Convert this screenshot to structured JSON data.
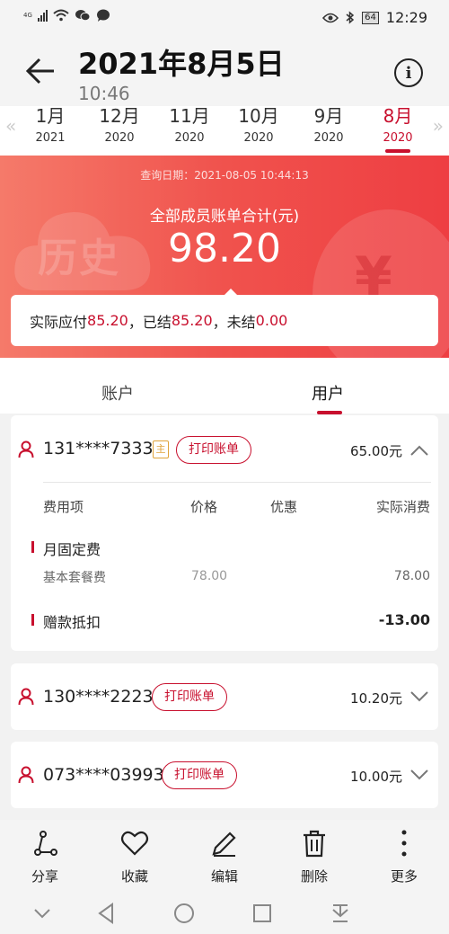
{
  "status_bar": {
    "network": "4G",
    "battery": "64",
    "time": "12:29"
  },
  "header": {
    "title": "2021年8月5日",
    "subtitle": "10:46"
  },
  "months": [
    {
      "month": "1月",
      "year": "2021"
    },
    {
      "month": "12月",
      "year": "2020"
    },
    {
      "month": "11月",
      "year": "2020"
    },
    {
      "month": "10月",
      "year": "2020"
    },
    {
      "month": "9月",
      "year": "2020"
    },
    {
      "month": "8月",
      "year": "2020"
    }
  ],
  "banner": {
    "query_date": "查询日期：2021-08-05 10:44:13",
    "total_label": "全部成员账单合计(元)",
    "total_value": "98.20",
    "watermark": "历史",
    "summary": {
      "payable_label": "实际应付",
      "payable_value": "85.20",
      "settled_label": "，已结",
      "settled_value": "85.20",
      "unsettled_label": "，未结",
      "unsettled_value": "0.00"
    }
  },
  "tabs": {
    "account": "账户",
    "user": "用户"
  },
  "bills": [
    {
      "phone": "131****7333",
      "badge": "主",
      "print_label": "打印账单",
      "amount": "65.00元",
      "expanded": true,
      "headers": {
        "item": "费用项",
        "price": "价格",
        "discount": "优惠",
        "actual": "实际消费"
      },
      "sections": [
        {
          "title": "月固定费",
          "rows": [
            {
              "name": "基本套餐费",
              "price": "78.00",
              "actual": "78.00"
            }
          ]
        },
        {
          "title": "赠款抵扣",
          "value": "-13.00"
        }
      ]
    },
    {
      "phone": "130****2223",
      "print_label": "打印账单",
      "amount": "10.20元",
      "expanded": false
    },
    {
      "phone": "073****03993",
      "print_label": "打印账单",
      "amount": "10.00元",
      "expanded": false
    }
  ],
  "toolbar": {
    "share": "分享",
    "favorite": "收藏",
    "edit": "编辑",
    "delete": "删除",
    "more": "更多"
  },
  "colors": {
    "accent": "#c8102e",
    "banner_start": "#f57a6a",
    "banner_end": "#ee3e42"
  }
}
